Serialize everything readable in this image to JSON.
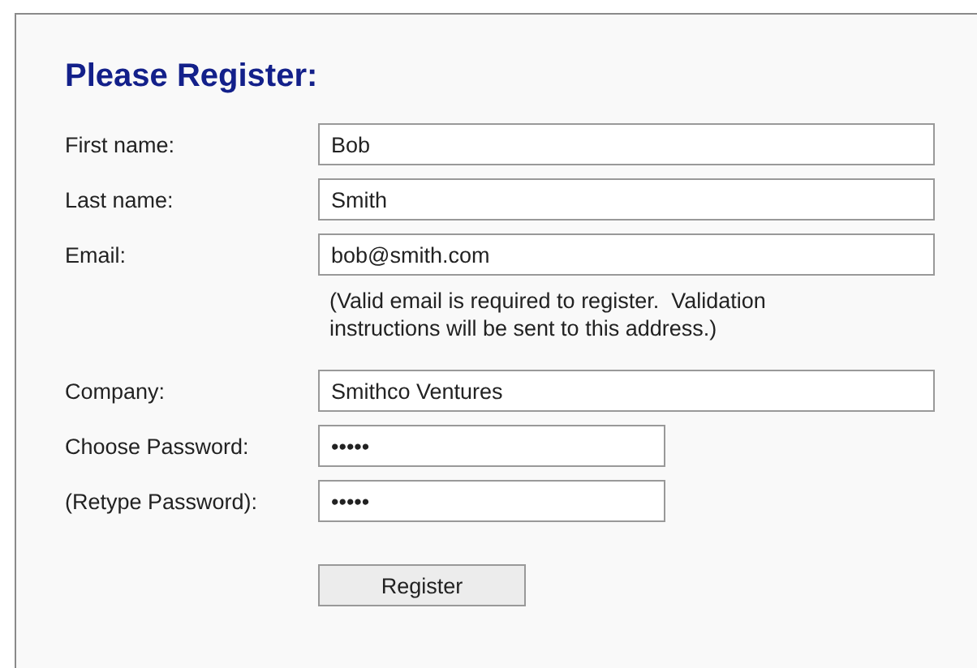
{
  "title": "Please Register:",
  "fields": [
    {
      "label": "First name:",
      "kind": "text",
      "value": "Bob"
    },
    {
      "label": "Last name:",
      "kind": "text",
      "value": "Smith"
    },
    {
      "label": "Email:",
      "kind": "text",
      "value": "bob@smith.com",
      "note": "(Valid email is required to register.  Validation instructions will be sent to this address.)"
    },
    {
      "label": "Company:",
      "kind": "text",
      "value": "Smithco Ventures"
    },
    {
      "label": "Choose Password:",
      "kind": "password",
      "value": "•••••"
    },
    {
      "label": "(Retype Password):",
      "kind": "password",
      "value": "•••••"
    }
  ],
  "button": "Register"
}
